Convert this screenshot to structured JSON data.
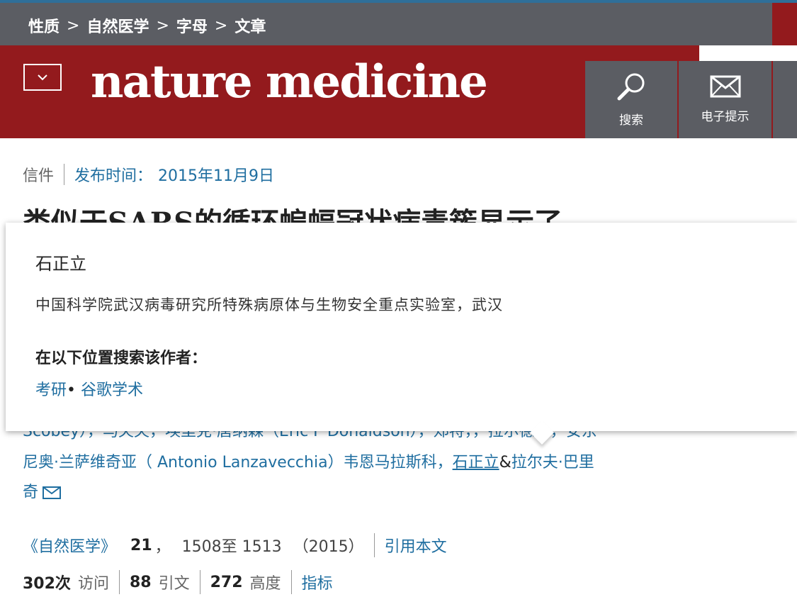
{
  "breadcrumb": [
    "性质",
    "自然医学",
    "字母",
    "文章"
  ],
  "breadcrumb_separator": ">",
  "header": {
    "logo": "nature medicine",
    "menu_icon": "chevron-down-icon",
    "search_label": "搜索",
    "search_icon": "search-icon",
    "alerts_label": "电子提示",
    "alerts_icon": "envelope-icon"
  },
  "article": {
    "type": "信件",
    "published_label": "发布时间：",
    "published_date": "2015年11月9日",
    "title": "类似于SARS的循环蝙蝠冠状病毒簇显示了",
    "authors_line_hidden": "Scobey），马夫夫，埃里克·唐纳森（Eric F Donaldson），郑特，，拉尔德斯，安东",
    "authors_line1": "尼奥·兰萨维奇亚（ Antonio Lanzavecchia）韦恩马拉斯科，",
    "highlighted_author": "石正立",
    "amp": "&",
    "last_author_part1": "拉尔夫·巴里",
    "last_author_part2": "奇"
  },
  "citation": {
    "journal": "《自然医学》",
    "volume": "21",
    "comma": "，",
    "pages": "1508至 1513",
    "year": "（2015）",
    "cite_label": "引用本文"
  },
  "metrics": {
    "accesses_count": "302次",
    "accesses_label": "访问",
    "citations_count": "88",
    "citations_label": "引文",
    "altmetric_count": "272",
    "altmetric_label": "高度",
    "metrics_link": "指标"
  },
  "popup": {
    "name": "石正立",
    "affiliation": "中国科学院武汉病毒研究所特殊病原体与生物安全重点实验室，武汉",
    "search_heading": "在以下位置搜索该作者：",
    "link1": "考研",
    "dot": "•",
    "link2": "谷歌学术"
  },
  "colors": {
    "brand_red": "#931a1d",
    "nav_gray": "#5b5d63",
    "link_blue": "#1f6ea0"
  }
}
